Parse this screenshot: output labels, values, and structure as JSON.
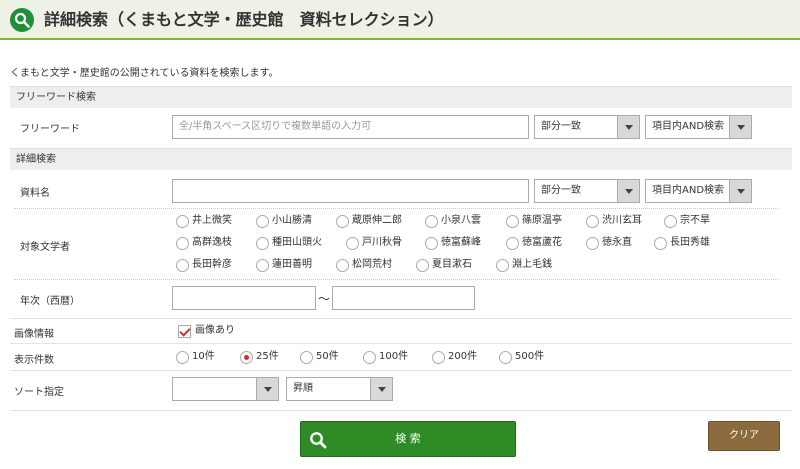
{
  "page": {
    "title": "詳細検索（くまもと文学・歴史館　資料セレクション）",
    "intro": "くまもと文学・歴史館の公開されている資料を検索します。"
  },
  "freeword_section": {
    "heading": "フリーワード検索",
    "label": "フリーワード",
    "placeholder": "全/半角スペース区切りで複数単語の入力可",
    "match_mode": "部分一致",
    "operator": "項目内AND検索"
  },
  "detail_section": {
    "heading": "詳細検索",
    "title_label": "資料名",
    "title_match_mode": "部分一致",
    "title_operator": "項目内AND検索",
    "authors_label": "対象文学者",
    "authors_row1": [
      "井上微笑",
      "小山勝清",
      "蔵原伸二郎",
      "小泉八雲",
      "篠原温亭",
      "渋川玄耳",
      "宗不旱"
    ],
    "authors_row2": [
      "高群逸枝",
      "種田山頭火",
      "戸川秋骨",
      "徳富蘇峰",
      "徳富蘆花",
      "徳永直",
      "長田秀雄"
    ],
    "authors_row3": [
      "長田幹彦",
      "蓮田善明",
      "松岡荒村",
      "夏目漱石",
      "淵上毛銭"
    ],
    "year_label": "年次（西暦）",
    "year_separator": "～"
  },
  "image_info": {
    "label": "画像情報",
    "checkbox_label": "画像あり",
    "checked": true
  },
  "display_count": {
    "label": "表示件数",
    "options": [
      "10件",
      "25件",
      "50件",
      "100件",
      "200件",
      "500件"
    ],
    "selected": "25件"
  },
  "sort": {
    "label": "ソート指定",
    "field_value": "",
    "order_value": "昇順"
  },
  "buttons": {
    "search": "検 索",
    "clear": "クリア"
  },
  "colors": {
    "header_bg": "#eef1e6",
    "header_accent": "#7bb043",
    "search_button": "#2e8b26",
    "clear_button": "#8b6a3e",
    "radio_checked": "#d32f2f"
  }
}
